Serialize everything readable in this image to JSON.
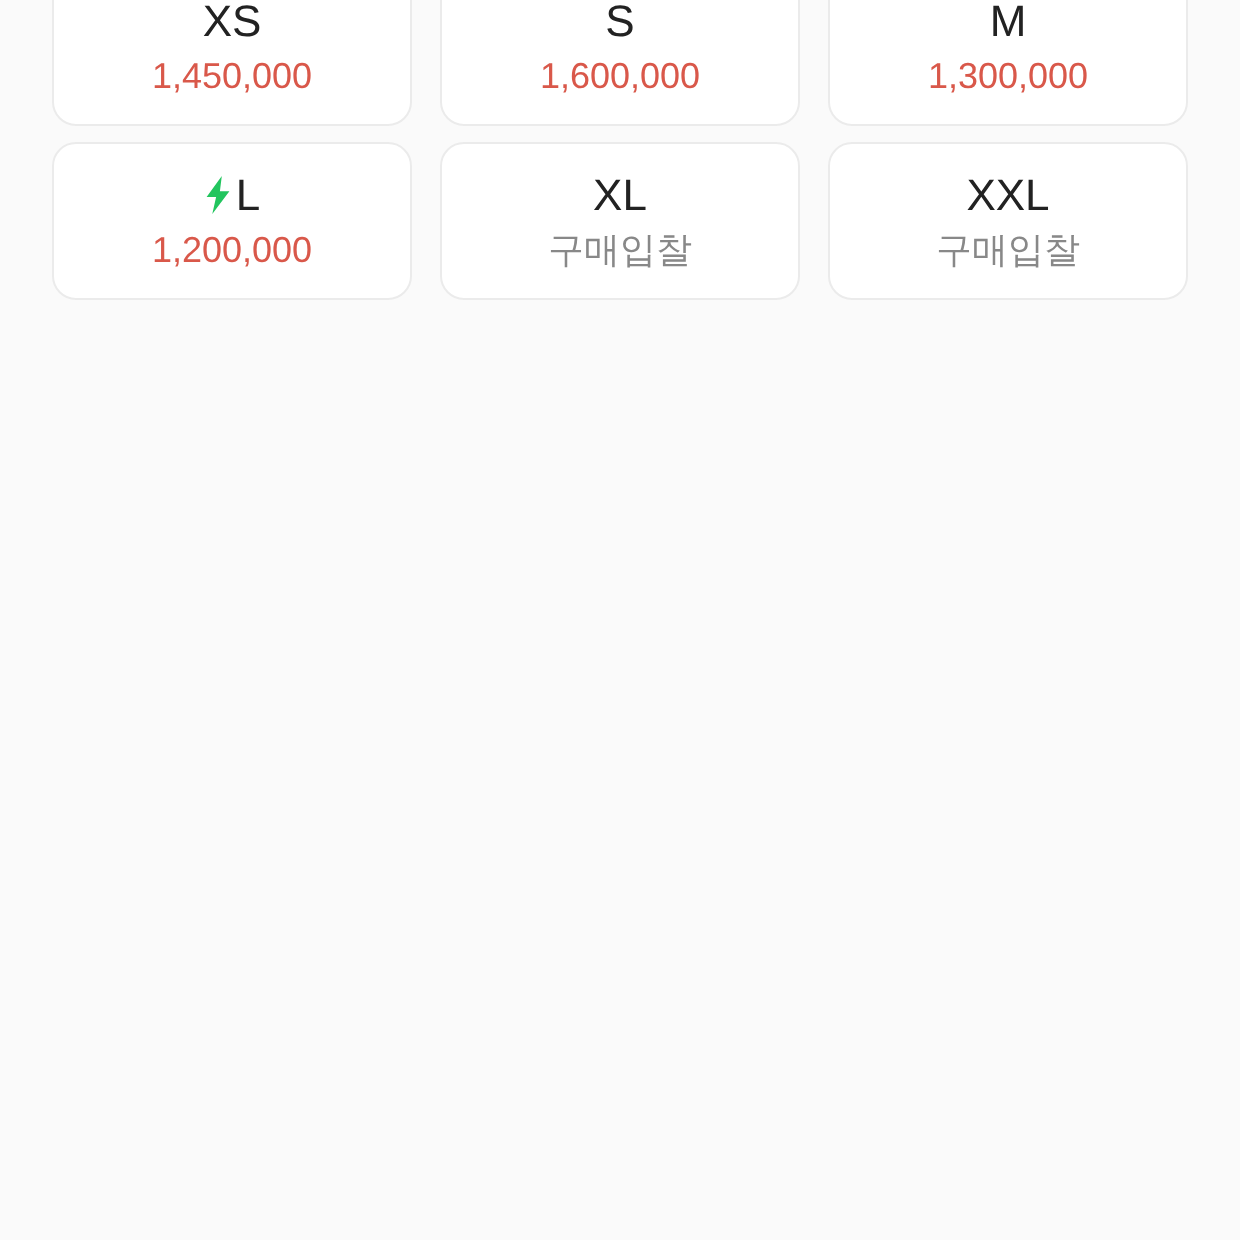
{
  "sizes": [
    {
      "size": "XS",
      "kind": "price",
      "value": "1,450,000",
      "fast": false
    },
    {
      "size": "S",
      "kind": "price",
      "value": "1,600,000",
      "fast": false
    },
    {
      "size": "M",
      "kind": "price",
      "value": "1,300,000",
      "fast": false
    },
    {
      "size": "L",
      "kind": "price",
      "value": "1,200,000",
      "fast": true
    },
    {
      "size": "XL",
      "kind": "bid",
      "value": "구매입찰",
      "fast": false
    },
    {
      "size": "XXL",
      "kind": "bid",
      "value": "구매입찰",
      "fast": false
    }
  ]
}
